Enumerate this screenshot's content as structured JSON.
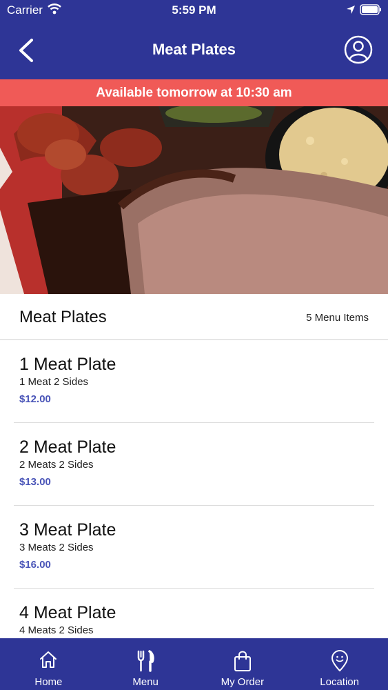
{
  "status": {
    "carrier": "Carrier",
    "time": "5:59 PM"
  },
  "header": {
    "title": "Meat Plates"
  },
  "banner": {
    "text": "Available tomorrow at 10:30 am"
  },
  "section": {
    "title": "Meat Plates",
    "count": "5 Menu Items"
  },
  "items": [
    {
      "name": "1 Meat Plate",
      "desc": "1 Meat 2 Sides",
      "price": "$12.00"
    },
    {
      "name": "2 Meat Plate",
      "desc": "2 Meats 2 Sides",
      "price": "$13.00"
    },
    {
      "name": "3 Meat Plate",
      "desc": "3 Meats 2 Sides",
      "price": "$16.00"
    },
    {
      "name": "4 Meat Plate",
      "desc": "4 Meats 2 Sides",
      "price": ""
    }
  ],
  "tabs": [
    {
      "label": "Home",
      "icon": "home-icon"
    },
    {
      "label": "Menu",
      "icon": "fork-knife-icon"
    },
    {
      "label": "My Order",
      "icon": "shopping-bag-icon"
    },
    {
      "label": "Location",
      "icon": "location-pin-icon"
    }
  ],
  "colors": {
    "header_bg": "#2e3596",
    "banner_bg": "#f05a57",
    "price": "#4a55b8"
  }
}
